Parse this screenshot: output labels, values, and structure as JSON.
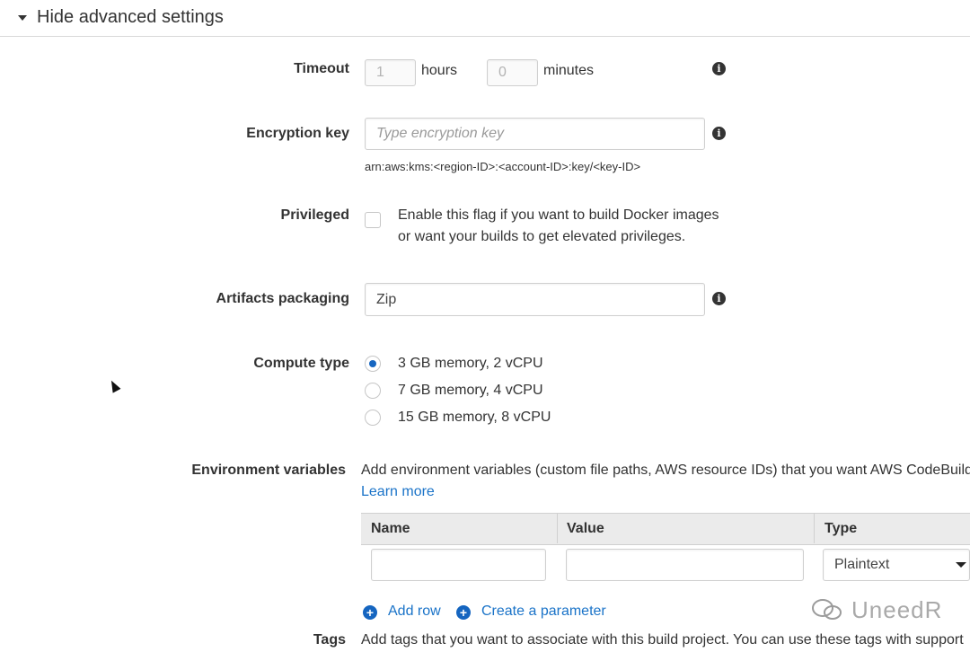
{
  "section": {
    "title": "Hide advanced settings"
  },
  "timeout": {
    "label": "Timeout",
    "hours_value": "1",
    "hours_unit": "hours",
    "minutes_value": "0",
    "minutes_unit": "minutes"
  },
  "encryption": {
    "label": "Encryption key",
    "placeholder": "Type encryption key",
    "hint": "arn:aws:kms:<region-ID>:<account-ID>:key/<key-ID>"
  },
  "privileged": {
    "label": "Privileged",
    "description_line1": "Enable this flag if you want to build Docker images",
    "description_line2": "or want your builds to get elevated privileges.",
    "checked": false
  },
  "artifacts": {
    "label": "Artifacts packaging",
    "value": "Zip"
  },
  "compute": {
    "label": "Compute type",
    "options": [
      {
        "label": "3 GB memory, 2 vCPU",
        "selected": true
      },
      {
        "label": "7 GB memory, 4 vCPU",
        "selected": false
      },
      {
        "label": "15 GB memory, 8 vCPU",
        "selected": false
      }
    ]
  },
  "env": {
    "label": "Environment variables",
    "description": "Add environment variables (custom file paths, AWS resource IDs) that you want AWS CodeBuild",
    "learn_more": "Learn more",
    "columns": [
      "Name",
      "Value",
      "Type"
    ],
    "row": {
      "name": "",
      "value": "",
      "type": "Plaintext"
    },
    "add_row": "Add row",
    "create_parameter": "Create a parameter"
  },
  "tags": {
    "label": "Tags",
    "description": "Add tags that you want to associate with this build project. You can use these tags with support"
  },
  "watermark": "UneedR",
  "colors": {
    "accent": "#1565c0",
    "link": "#1a73c8",
    "info": "#333333"
  },
  "icons": {
    "info": "info-icon",
    "add": "plus-circle-icon",
    "collapse": "caret-down-icon"
  }
}
